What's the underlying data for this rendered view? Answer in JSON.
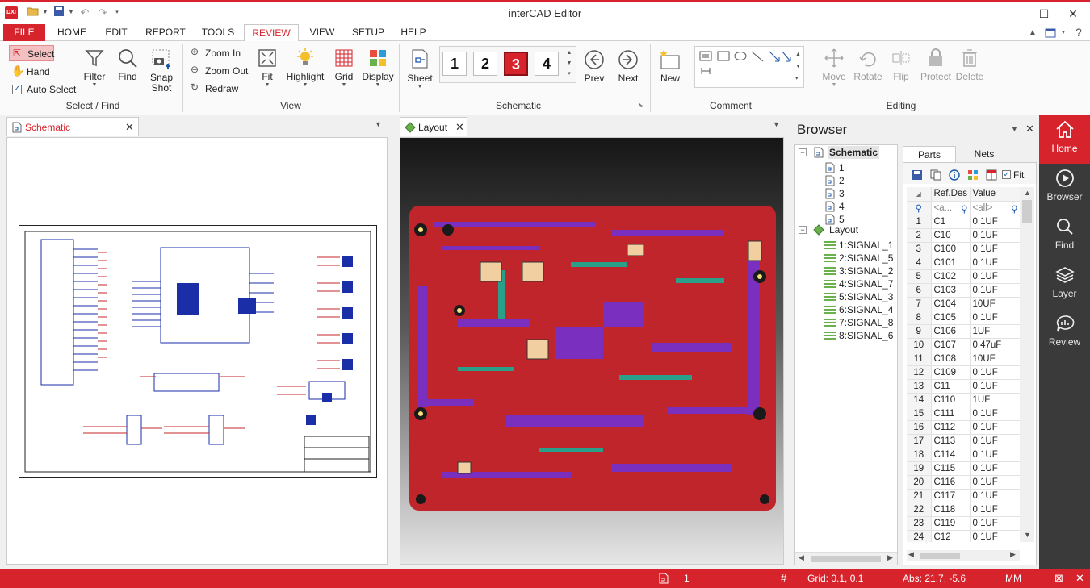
{
  "app": {
    "title": "interCAD Editor",
    "logo": "DXI"
  },
  "menu": {
    "file": "FILE",
    "home": "HOME",
    "edit": "EDIT",
    "report": "REPORT",
    "tools": "TOOLS",
    "review": "REVIEW",
    "view": "VIEW",
    "setup": "SETUP",
    "help": "HELP"
  },
  "ribbon": {
    "select_find": {
      "label": "Select / Find",
      "select": "Select",
      "hand": "Hand",
      "auto_select": "Auto Select",
      "filter": "Filter",
      "find": "Find",
      "snap_shot": "Snap\nShot"
    },
    "view": {
      "label": "View",
      "zoom_in": "Zoom In",
      "zoom_out": "Zoom Out",
      "redraw": "Redraw",
      "fit": "Fit",
      "highlight": "Highlight",
      "grid": "Grid",
      "display": "Display"
    },
    "schematic": {
      "label": "Schematic",
      "sheet": "Sheet",
      "pages": [
        "1",
        "2",
        "3",
        "4"
      ],
      "active_page": "3",
      "prev": "Prev",
      "next": "Next"
    },
    "comment": {
      "label": "Comment",
      "new": "New"
    },
    "editing": {
      "label": "Editing",
      "move": "Move",
      "rotate": "Rotate",
      "flip": "Flip",
      "protect": "Protect",
      "delete": "Delete"
    }
  },
  "tabs": {
    "schematic": "Schematic",
    "layout": "Layout"
  },
  "browser": {
    "title": "Browser",
    "tree": {
      "schematic": "Schematic",
      "sheets": [
        "1",
        "2",
        "3",
        "4",
        "5"
      ],
      "layout": "Layout",
      "layers": [
        "1:SIGNAL_1",
        "2:SIGNAL_5",
        "3:SIGNAL_2",
        "4:SIGNAL_7",
        "5:SIGNAL_3",
        "6:SIGNAL_4",
        "7:SIGNAL_8",
        "8:SIGNAL_6"
      ]
    },
    "parts_tab": "Parts",
    "nets_tab": "Nets",
    "fit_label": "Fit",
    "columns": {
      "ref": "Ref.Des",
      "value": "Value"
    },
    "filters": {
      "ref": "<a...",
      "value": "<all>"
    },
    "rows": [
      [
        "1",
        "C1",
        "0.1UF"
      ],
      [
        "2",
        "C10",
        "0.1UF"
      ],
      [
        "3",
        "C100",
        "0.1UF"
      ],
      [
        "4",
        "C101",
        "0.1UF"
      ],
      [
        "5",
        "C102",
        "0.1UF"
      ],
      [
        "6",
        "C103",
        "0.1UF"
      ],
      [
        "7",
        "C104",
        "10UF"
      ],
      [
        "8",
        "C105",
        "0.1UF"
      ],
      [
        "9",
        "C106",
        "1UF"
      ],
      [
        "10",
        "C107",
        "0.47uF"
      ],
      [
        "11",
        "C108",
        "10UF"
      ],
      [
        "12",
        "C109",
        "0.1UF"
      ],
      [
        "13",
        "C11",
        "0.1UF"
      ],
      [
        "14",
        "C110",
        "1UF"
      ],
      [
        "15",
        "C111",
        "0.1UF"
      ],
      [
        "16",
        "C112",
        "0.1UF"
      ],
      [
        "17",
        "C113",
        "0.1UF"
      ],
      [
        "18",
        "C114",
        "0.1UF"
      ],
      [
        "19",
        "C115",
        "0.1UF"
      ],
      [
        "20",
        "C116",
        "0.1UF"
      ],
      [
        "21",
        "C117",
        "0.1UF"
      ],
      [
        "22",
        "C118",
        "0.1UF"
      ],
      [
        "23",
        "C119",
        "0.1UF"
      ],
      [
        "24",
        "C12",
        "0.1UF"
      ]
    ]
  },
  "rightbar": {
    "home": "Home",
    "browser": "Browser",
    "find": "Find",
    "layer": "Layer",
    "review": "Review"
  },
  "status": {
    "page": "1",
    "grid": "Grid: 0.1, 0.1",
    "abs": "Abs: 21.7, -5.6",
    "units": "MM"
  },
  "colors": {
    "accent": "#d7232b",
    "board": "#c0252b",
    "sidebar": "#3a3a3a"
  }
}
